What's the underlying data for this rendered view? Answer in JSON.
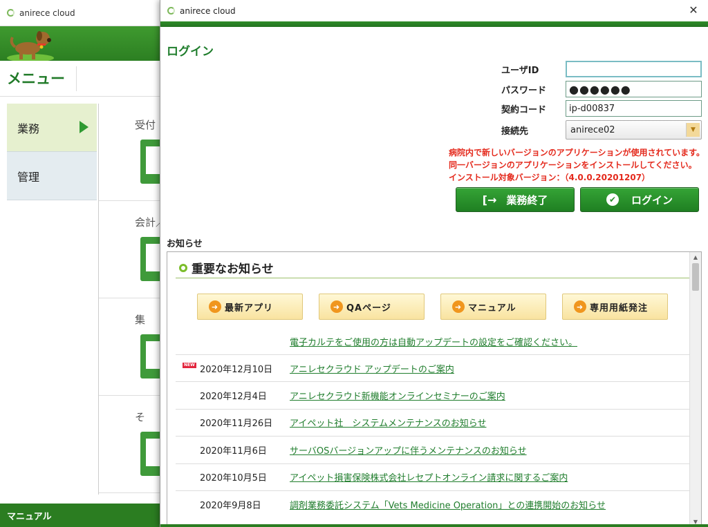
{
  "background_window": {
    "title": "anirece cloud",
    "menu_heading": "メニュー",
    "nav": [
      {
        "label": "業務"
      },
      {
        "label": "管理"
      }
    ],
    "tiles": [
      {
        "label": "受付"
      },
      {
        "label": "会計／"
      },
      {
        "label": "集"
      },
      {
        "label": "そ"
      }
    ],
    "footer": "マニュアル"
  },
  "dialog": {
    "title": "anirece cloud",
    "close_label": "✕",
    "login_title": "ログイン",
    "form": {
      "userid_label": "ユーザID",
      "userid_value": "",
      "password_label": "パスワード",
      "password_value": "●●●●●●",
      "contract_label": "契約コード",
      "contract_value": "ip-d00837",
      "connection_label": "接続先",
      "connection_value": "anirece02"
    },
    "warning": [
      "病院内で新しいバージョンのアプリケーションが使用されています。",
      "同一バージョンのアプリケーションをインストールしてください。",
      "インストール対象バージョン：（4.0.0.20201207）"
    ],
    "buttons": {
      "exit": "業務終了",
      "login": "ログイン"
    },
    "notices_label": "お知らせ",
    "important_heading": "重要なお知らせ",
    "quick_buttons": [
      {
        "label": "最新アプリ"
      },
      {
        "label": "QAページ"
      },
      {
        "label": "マニュアル"
      },
      {
        "label": "専用用紙発注"
      }
    ],
    "auto_update_link": "電子カルテをご使用の方は自動アップデートの設定をご確認ください。",
    "new_badge": "NEW",
    "news": [
      {
        "date": "2020年12月10日",
        "title": "アニレセクラウド アップデートのご案内"
      },
      {
        "date": "2020年12月4日",
        "title": "アニレセクラウド新機能オンラインセミナーのご案内"
      },
      {
        "date": "2020年11月26日",
        "title": "アイペット社　システムメンテナンスのお知らせ"
      },
      {
        "date": "2020年11月6日",
        "title": "サーバOSバージョンアップに伴うメンテナンスのお知らせ"
      },
      {
        "date": "2020年10月5日",
        "title": "アイペット損害保険株式会社レセプトオンライン請求に関するご案内"
      },
      {
        "date": "2020年9月8日",
        "title": "調剤業務委託システム「Vets Medicine Operation」との連携開始のお知らせ"
      }
    ]
  },
  "colors": {
    "brand_green": "#2f8d28",
    "link_green": "#1f7d2c",
    "warning_red": "#e42a1d"
  }
}
